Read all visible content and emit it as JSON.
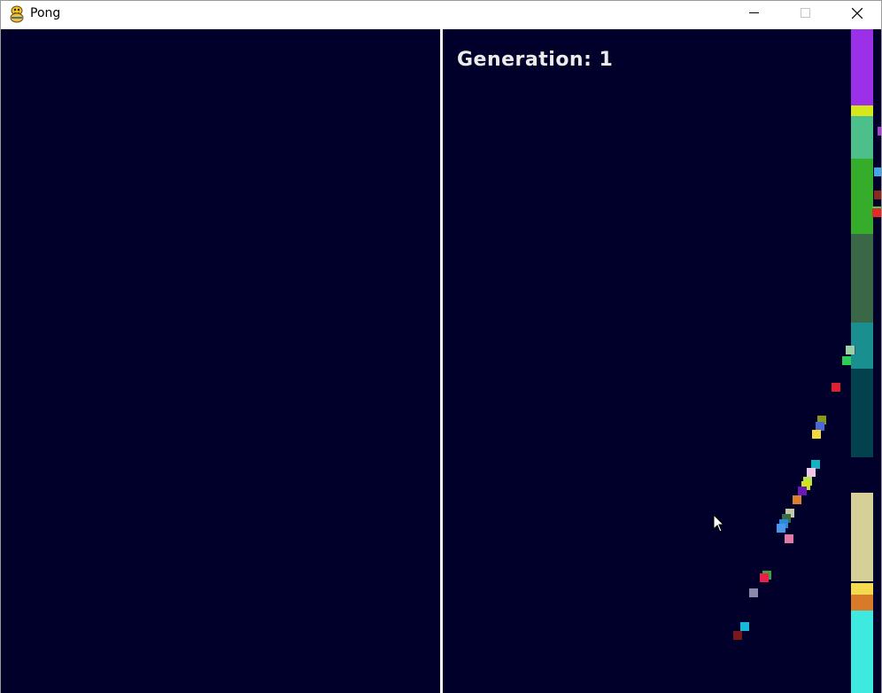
{
  "window": {
    "title": "Pong",
    "app_icon": "python-snake-icon",
    "controls": {
      "minimize_icon": "minimize-icon",
      "maximize_icon": "maximize-icon",
      "close_icon": "close-icon"
    }
  },
  "game": {
    "generation_label": "Generation: 1",
    "background_color": "#00002a",
    "net_color": "#f2f2f2",
    "paddles": [
      {
        "color": "#9b30e8"
      },
      {
        "color": "#d7e81a"
      },
      {
        "color": "#4dbf8a"
      },
      {
        "color": "#35ad2a"
      },
      {
        "color": "#3a6847"
      },
      {
        "color": "#1a8f8f"
      },
      {
        "color": "#04414f"
      },
      {
        "color": "#d6cf98"
      },
      {
        "color": "#f4db4e"
      },
      {
        "color": "#d97a2a"
      },
      {
        "color": "#3eeadf"
      }
    ],
    "balls": [
      {
        "color": "#3d4e8a"
      },
      {
        "color": "#9ad0a4"
      },
      {
        "color": "#2ecc58"
      },
      {
        "color": "#e02030"
      },
      {
        "color": "#8a9a18"
      },
      {
        "color": "#4a6ad8"
      },
      {
        "color": "#f4d838"
      },
      {
        "color": "#1ab0c4"
      },
      {
        "color": "#f0c8e8"
      },
      {
        "color": "#b8e24e"
      },
      {
        "color": "#d4e41c"
      },
      {
        "color": "#6a1ab8"
      },
      {
        "color": "#d88030"
      },
      {
        "color": "#c8c8a8"
      },
      {
        "color": "#3a6a4a"
      },
      {
        "color": "#2a8ad8"
      },
      {
        "color": "#4898f0"
      },
      {
        "color": "#e078a8"
      },
      {
        "color": "#40a040"
      },
      {
        "color": "#e8204a"
      },
      {
        "color": "#8a8aa8"
      },
      {
        "color": "#18b8d8"
      },
      {
        "color": "#781818"
      },
      {
        "color": "#a840d8"
      },
      {
        "color": "#40a8e8"
      },
      {
        "color": "#8a2a1a"
      },
      {
        "color": "#3ad848"
      },
      {
        "color": "#e82828"
      }
    ]
  }
}
